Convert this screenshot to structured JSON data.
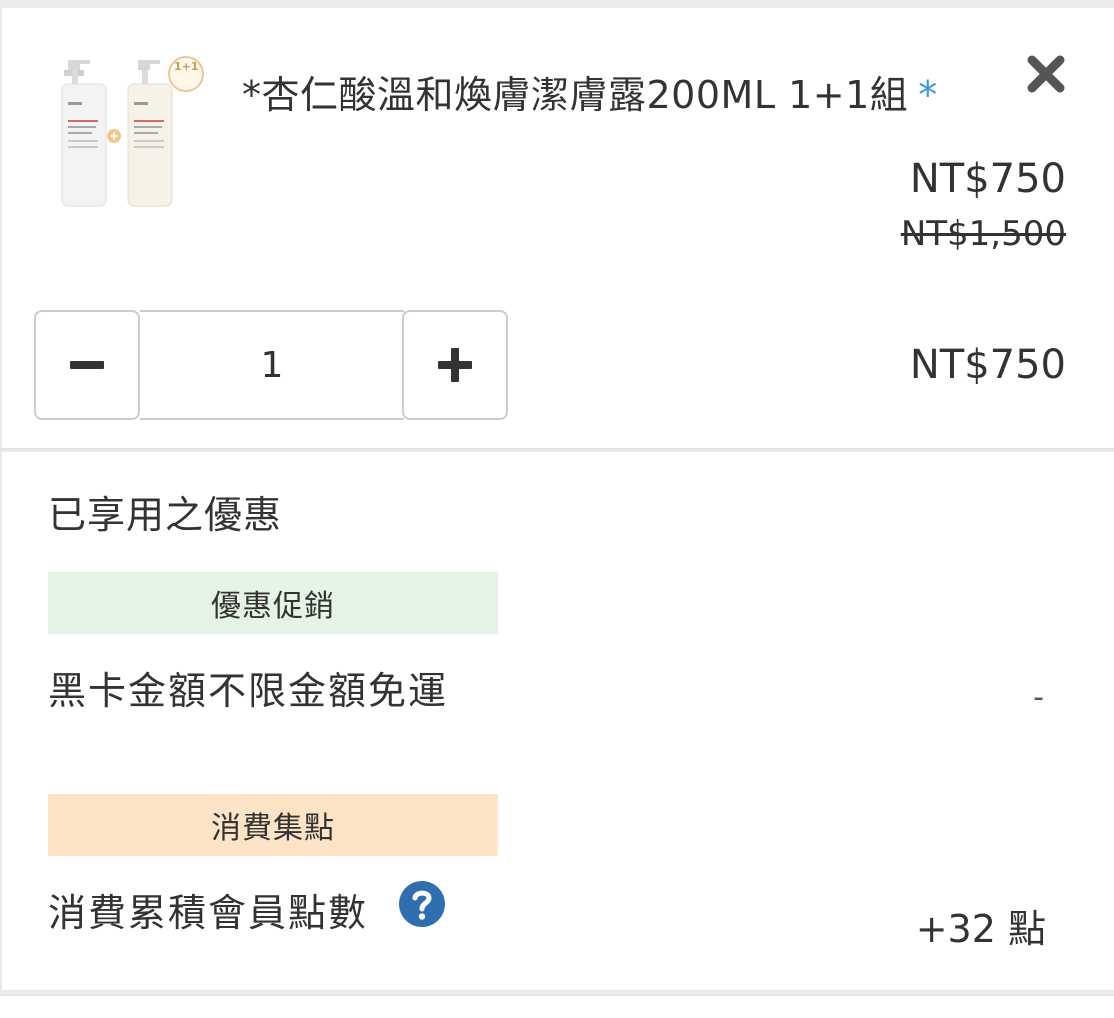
{
  "product": {
    "title": "*杏仁酸溫和煥膚潔膚露200ML 1+1組",
    "required_mark": "*",
    "image_badge": "1+1",
    "price_current": "NT$750",
    "price_original": "NT$1,500",
    "quantity": "1",
    "line_total": "NT$750"
  },
  "promotions": {
    "section_title": "已享用之優惠",
    "promo_badge": "優惠促銷",
    "promo_name": "黑卡金額不限金額免運",
    "promo_value": "-",
    "points_badge": "消費集點",
    "points_name": "消費累積會員點數",
    "points_value": "+32 點"
  },
  "icons": {
    "close": "close-icon",
    "minus": "minus-icon",
    "plus": "plus-icon",
    "help": "question-circle-icon"
  },
  "colors": {
    "accent_star": "#3a98d8",
    "help_icon": "#2f6fb0",
    "promo_badge_bg": "#e6f4e6",
    "points_badge_bg": "#fde4c6"
  }
}
